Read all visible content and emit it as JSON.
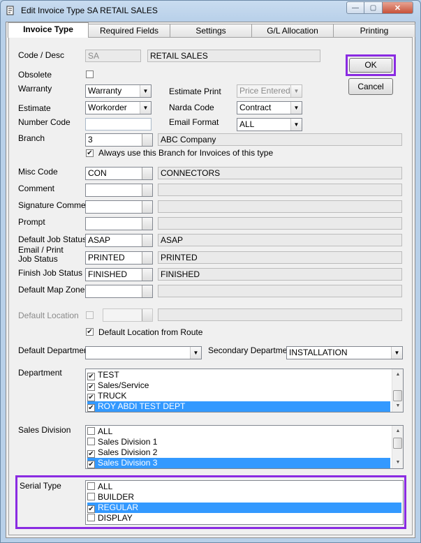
{
  "window": {
    "title": "Edit Invoice Type  SA RETAIL SALES",
    "minimize_glyph": "—",
    "maximize_glyph": "▢",
    "close_glyph": "✕"
  },
  "tabs": [
    {
      "label": "Invoice Type",
      "active": true
    },
    {
      "label": "Required Fields",
      "active": false
    },
    {
      "label": "Settings",
      "active": false
    },
    {
      "label": "G/L Allocation",
      "active": false
    },
    {
      "label": "Printing",
      "active": false
    }
  ],
  "buttons": {
    "ok": "OK",
    "cancel": "Cancel"
  },
  "colors": {
    "highlight": "#8a2be2",
    "selection": "#3399ff"
  },
  "form": {
    "code_desc_label": "Code / Desc",
    "code": "SA",
    "desc": "RETAIL SALES",
    "obsolete_label": "Obsolete",
    "obsolete_checked": false,
    "warranty_label": "Warranty",
    "warranty_value": "Warranty",
    "estimate_print_label": "Estimate Print",
    "estimate_print_value": "Price Entered",
    "estimate_label": "Estimate",
    "estimate_value": "Workorder",
    "narda_code_label": "Narda  Code",
    "narda_code_value": "Contract",
    "number_code_label": "Number  Code",
    "number_code_value": "",
    "email_format_label": "Email Format",
    "email_format_value": "ALL",
    "branch_label": "Branch",
    "branch_code": "3",
    "branch_name": "ABC Company",
    "always_branch_label": "Always use this Branch for Invoices of this type",
    "always_branch_checked": true,
    "misc_code_label": "Misc Code",
    "misc_code": "CON",
    "misc_desc": "CONNECTORS",
    "comment_label": "Comment",
    "comment_value": "",
    "signature_comment_label": "Signature Comment",
    "signature_comment_value": "",
    "prompt_label": "Prompt",
    "prompt_value": "",
    "default_job_status_label": "Default Job Status",
    "default_job_status_code": "ASAP",
    "default_job_status_desc": "ASAP",
    "email_print_label_1": "Email / Print",
    "email_print_label_2": "Job Status",
    "email_print_code": "PRINTED",
    "email_print_desc": "PRINTED",
    "finish_job_status_label": "Finish Job Status",
    "finish_job_status_code": "FINISHED",
    "finish_job_status_desc": "FINISHED",
    "default_map_zone_label": "Default Map Zone",
    "default_map_zone_value": "",
    "default_location_label": "Default Location",
    "default_location_value": "",
    "default_location_from_route_label": "Default Location from Route",
    "default_location_from_route_checked": true,
    "default_department_label": "Default Department",
    "default_department_value": "",
    "secondary_department_label": "Secondary Department",
    "secondary_department_value": "INSTALLATION",
    "department_label": "Department",
    "sales_division_label": "Sales Division",
    "serial_type_label": "Serial Type"
  },
  "department_items": [
    {
      "label": "TEST",
      "checked": true,
      "selected": false
    },
    {
      "label": "Sales/Service",
      "checked": true,
      "selected": false
    },
    {
      "label": "TRUCK",
      "checked": true,
      "selected": false
    },
    {
      "label": "ROY ABDI TEST DEPT",
      "checked": true,
      "selected": true
    }
  ],
  "sales_division_items": [
    {
      "label": "ALL",
      "checked": false,
      "selected": false
    },
    {
      "label": "Sales Division 1",
      "checked": false,
      "selected": false
    },
    {
      "label": "Sales Division 2",
      "checked": true,
      "selected": false
    },
    {
      "label": "Sales Division 3",
      "checked": true,
      "selected": true
    }
  ],
  "serial_type_items": [
    {
      "label": "ALL",
      "checked": false,
      "selected": false
    },
    {
      "label": "BUILDER",
      "checked": false,
      "selected": false
    },
    {
      "label": "REGULAR",
      "checked": true,
      "selected": true
    },
    {
      "label": "DISPLAY",
      "checked": false,
      "selected": false
    }
  ]
}
